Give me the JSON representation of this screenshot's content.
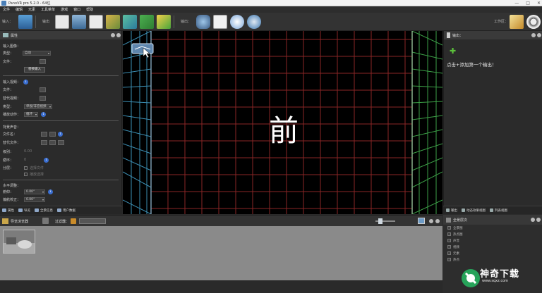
{
  "window": {
    "title": "PanoVR pro 5.2.0 - 64位",
    "controls": [
      "—",
      "□",
      "✕"
    ]
  },
  "menu": [
    "文件",
    "编辑",
    "元素",
    "工具菜单",
    "游戏",
    "窗口",
    "帮助"
  ],
  "toolbar": {
    "input_label": "输入：",
    "output_label": "输出：",
    "mode_label": "输出",
    "workspace_label": "工作区："
  },
  "properties": {
    "title": "属性",
    "sections": {
      "input_image": "输入图像：",
      "type_label": "类型：",
      "type_value": "自动",
      "file_label": "文件：",
      "replace_button": "替换输入",
      "input_video": "输入视频：",
      "video_file_label": "文件：",
      "alt_file_label": "替代视频：",
      "video_type_label": "类型：",
      "video_type_value": "单视/非音视频",
      "play_mode_label": "播放动作：",
      "play_mode_value": "循环",
      "audio": "背景声音：",
      "audio_file_label": "文件名：",
      "audio_alt_label": "替代文件：",
      "level_label": "级别：",
      "level_value": "0.00",
      "loop_label": "循环：",
      "loop_value": "0",
      "extra_label": "分层：",
      "opt1": "选择文件",
      "opt2": "播放选择",
      "horizon": "水平调整：",
      "tilt_label": "俯仰：",
      "tilt_value": "0.00°",
      "roll_label": "偏航校正：",
      "roll_value": "0.00°"
    },
    "tabs": [
      "属性",
      "导览",
      "全景信息",
      "用户数据"
    ]
  },
  "viewport": {
    "cube_face_label": "前"
  },
  "output": {
    "title": "输出：",
    "hint": "点击+添加第一个输出！",
    "tabs": [
      "输出",
      "动态效果视图",
      "列表视图"
    ]
  },
  "browser": {
    "title": "导览浏览器",
    "filter_label": "过滤器："
  },
  "right_list": {
    "title": "全景层次",
    "items": [
      "全景图",
      "热点图",
      "声音",
      "视频",
      "元素",
      "热点"
    ]
  },
  "watermark": {
    "text": "神奇下载",
    "sub": "www.sqxz.com"
  },
  "colors": {
    "grid_red": "#8a2626",
    "grid_blue": "#3c8fb4",
    "grid_green": "#3ca047",
    "accent_green": "#5cc23b"
  }
}
